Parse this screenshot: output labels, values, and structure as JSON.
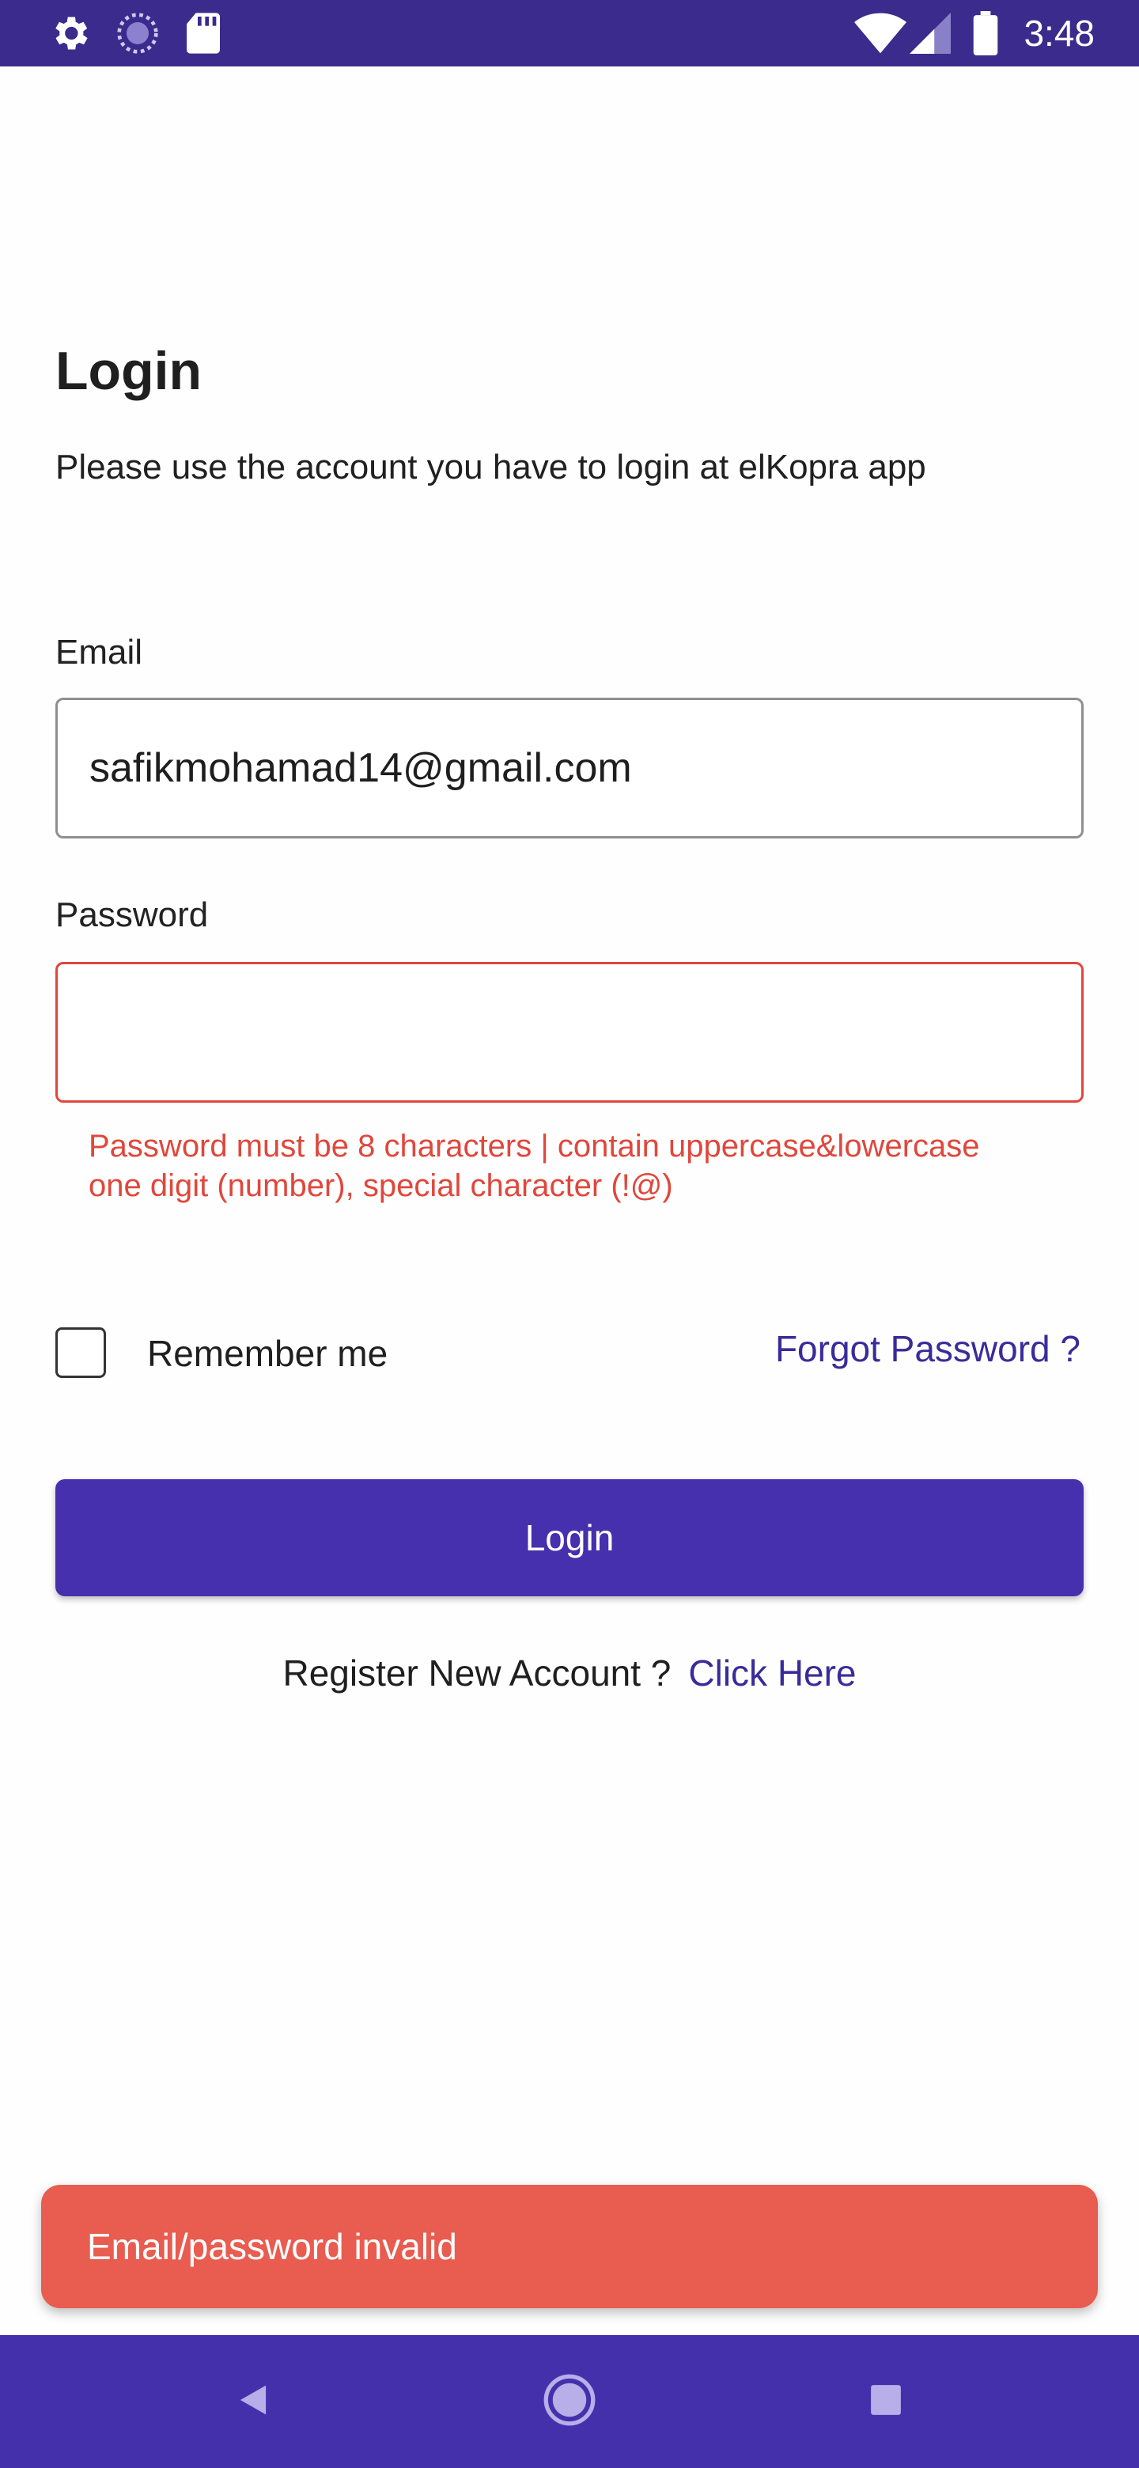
{
  "status_bar": {
    "time": "3:48",
    "left_icons": [
      "settings-gear-icon",
      "loading-spinner-icon",
      "sd-card-icon"
    ],
    "right_icons": [
      "wifi-icon",
      "cell-signal-icon",
      "battery-icon"
    ],
    "color": "#3a2b8c"
  },
  "login": {
    "title": "Login",
    "subtitle": "Please use the account you have to login at elKopra app",
    "email_label": "Email",
    "email_value": "safikmohamad14@gmail.com",
    "password_label": "Password",
    "password_value": "",
    "password_error_line1": "Password must be 8 characters | contain uppercase&lowercase",
    "password_error_line2": "one digit (number), special character (!@)",
    "remember_label": "Remember me",
    "remember_checked": false,
    "forgot_label": "Forgot Password ?",
    "login_button": "Login",
    "register_text": "Register New Account ?",
    "register_link": "Click Here"
  },
  "snackbar": {
    "message": "Email/password invalid",
    "color": "#e95c50"
  },
  "nav_bar": {
    "color": "#4530ac",
    "buttons": [
      "back-icon",
      "home-icon",
      "recent-apps-icon"
    ]
  },
  "colors": {
    "primary": "#4630ad",
    "link": "#3a2b9a",
    "error": "#e0473c"
  }
}
